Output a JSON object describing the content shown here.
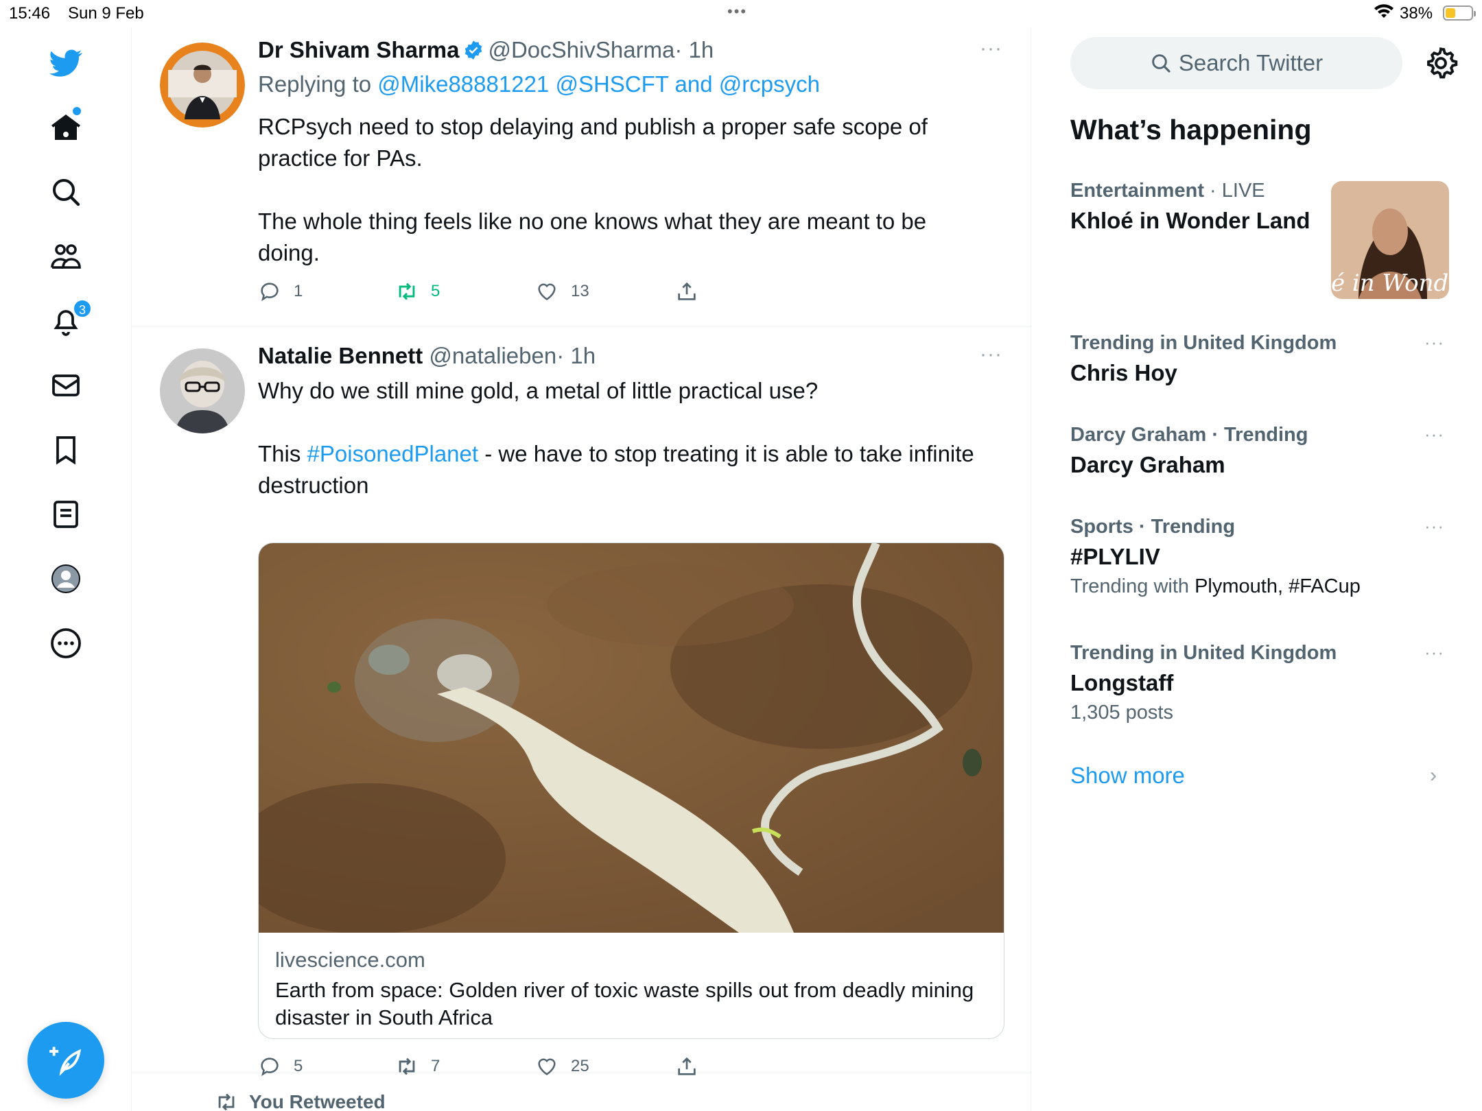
{
  "status_bar": {
    "time": "15:46",
    "date": "Sun 9 Feb",
    "battery": "38%",
    "battery_level": 0.38
  },
  "nav": {
    "notifications_count": "3",
    "icons": [
      "twitter-logo-icon",
      "home-icon",
      "search-icon",
      "communities-icon",
      "notifications-icon",
      "messages-icon",
      "bookmarks-icon",
      "lists-icon",
      "profile-icon",
      "more-icon",
      "compose-icon"
    ]
  },
  "tweets": [
    {
      "name": "Dr Shivam Sharma",
      "handle": "@DocShivSharma",
      "time": "· 1h",
      "replying_prefix": "Replying to",
      "replying_to": "@Mike88881221 @SHSCFT and @rcpsych",
      "text_1": "RCPsych need to stop delaying and publish a proper safe scope of practice for PAs.",
      "text_2": "The whole thing feels like no one knows what they are meant to be doing.",
      "replies": "1",
      "retweets": "5",
      "likes": "13",
      "more": "···"
    },
    {
      "name": "Natalie Bennett",
      "handle": "@natalieben",
      "time": "· 1h",
      "text_1": "Why do we still mine gold, a metal of little practical use?",
      "text_2_pre": "This ",
      "hashtag": "#PoisonedPlanet",
      "text_2_post": " - we have to stop treating it is able to take infinite destruction",
      "card_domain": "livescience.com",
      "card_title": "Earth from space: Golden river of toxic waste spills out from deadly mining disaster in South Africa",
      "replies": "5",
      "retweets": "7",
      "likes": "25",
      "more": "···"
    }
  ],
  "you_retweeted": "You Retweeted",
  "sidebar": {
    "search_placeholder": "Search Twitter",
    "whats_happening": "What’s happening",
    "trends": [
      {
        "meta": "Entertainment",
        "meta_extra": "· LIVE",
        "name": "Khloé in Wonder Land",
        "image_text": "é in Wonder L"
      },
      {
        "meta": "Trending in United Kingdom",
        "name": "Chris Hoy"
      },
      {
        "meta": "Darcy Graham · Trending",
        "name": "Darcy Graham"
      },
      {
        "meta": "Sports · Trending",
        "name": "#PLYLIV",
        "sub_prefix": "Trending with",
        "sub_value": "Plymouth, #FACup"
      },
      {
        "meta": "Trending in United Kingdom",
        "name": "Longstaff",
        "sub": "1,305 posts"
      }
    ],
    "show_more": "Show more"
  },
  "colors": {
    "accent": "#1d9bf0",
    "retweet_active": "#00ba7c",
    "text_primary": "#0f1419",
    "text_secondary": "#536471"
  }
}
